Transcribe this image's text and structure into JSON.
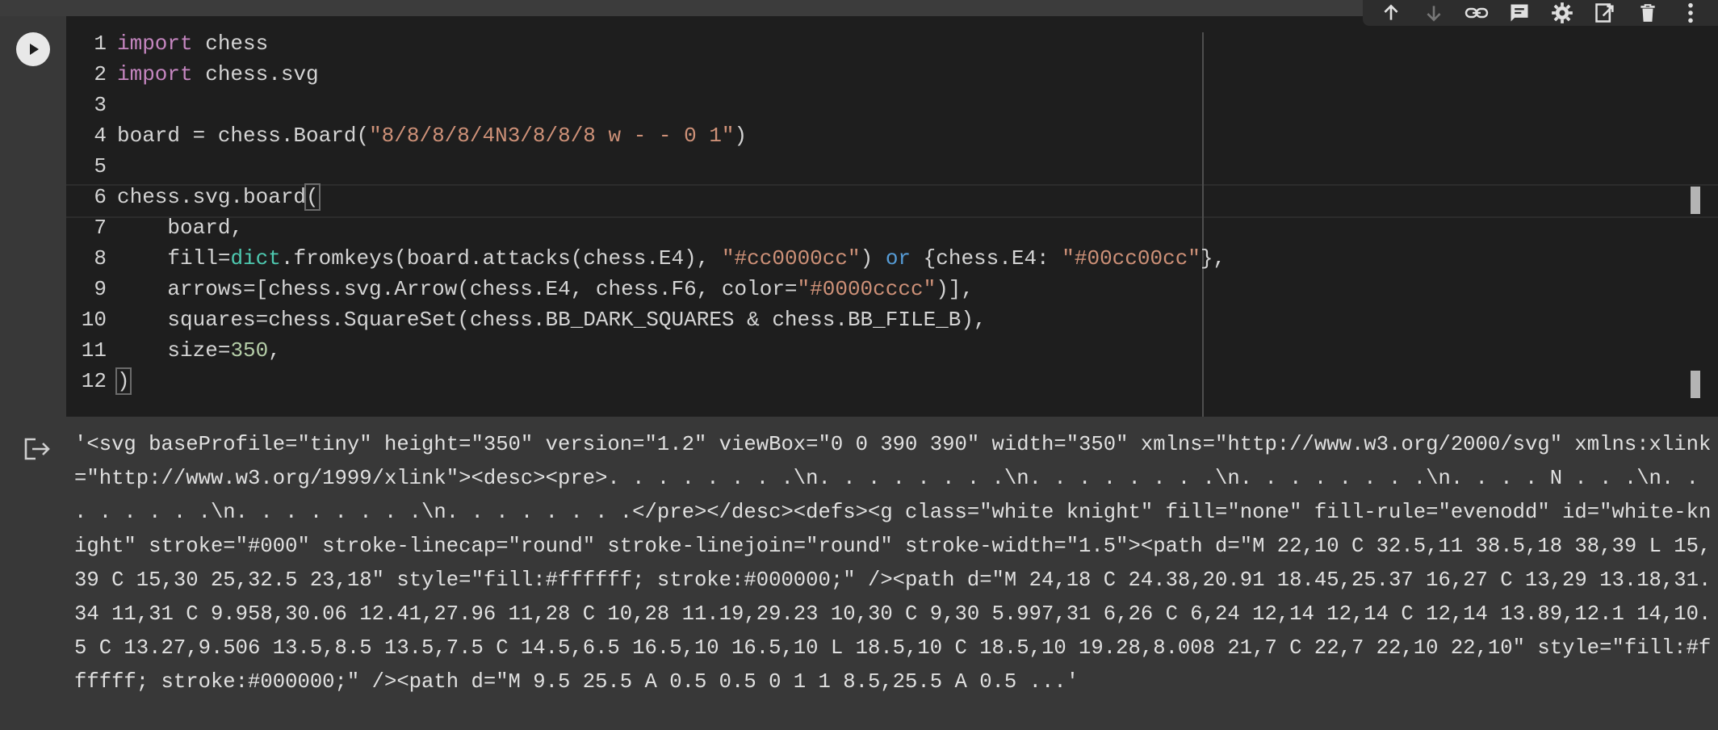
{
  "editor": {
    "line_numbers": [
      "1",
      "2",
      "3",
      "4",
      "5",
      "6",
      "7",
      "8",
      "9",
      "10",
      "11",
      "12"
    ],
    "tokens": {
      "l1_kw": "import",
      "l1_rest": " chess",
      "l2_kw": "import",
      "l2_rest": " chess.svg",
      "l4_a": "board = chess.Board(",
      "l4_str": "\"8/8/8/8/4N3/8/8/8 w - - 0 1\"",
      "l4_b": ")",
      "l6_a": "chess.svg.board",
      "l6_paren": "(",
      "l7": "    board,",
      "l8_a": "    fill=",
      "l8_dict": "dict",
      "l8_b": ".fromkeys(board.attacks(chess.E4), ",
      "l8_str1": "\"#cc0000cc\"",
      "l8_c": ") ",
      "l8_or": "or",
      "l8_d": " {chess.E4: ",
      "l8_str2": "\"#00cc00cc\"",
      "l8_e": "},",
      "l9_a": "    arrows=[chess.svg.Arrow(chess.E4, chess.F6, color=",
      "l9_str": "\"#0000cccc\"",
      "l9_b": ")],",
      "l10": "    squares=chess.SquareSet(chess.BB_DARK_SQUARES & chess.BB_FILE_B),",
      "l11_a": "    size=",
      "l11_num": "350",
      "l11_b": ",",
      "l12_paren": ")"
    }
  },
  "toolbar": {
    "icons": [
      "arrow-up-icon",
      "arrow-down-icon",
      "link-icon",
      "comment-icon",
      "gear-icon",
      "mirror-cell-icon",
      "trash-icon",
      "more-vert-icon"
    ]
  },
  "output": {
    "text": "'<svg baseProfile=\"tiny\" height=\"350\" version=\"1.2\" viewBox=\"0 0 390 390\" width=\"350\" xmlns=\"http://www.w3.org/2000/svg\" xmlns:xlink=\"http://www.w3.org/1999/xlink\"><desc><pre>. . . . . . . .\\n. . . . . . . .\\n. . . . . . . .\\n. . . . . . . .\\n. . . . N . . .\\n. . . . . . . .\\n. . . . . . . .\\n. . . . . . . .</pre></desc><defs><g class=\"white knight\" fill=\"none\" fill-rule=\"evenodd\" id=\"white-knight\" stroke=\"#000\" stroke-linecap=\"round\" stroke-linejoin=\"round\" stroke-width=\"1.5\"><path d=\"M 22,10 C 32.5,11 38.5,18 38,39 L 15,39 C 15,30 25,32.5 23,18\" style=\"fill:#ffffff; stroke:#000000;\" /><path d=\"M 24,18 C 24.38,20.91 18.45,25.37 16,27 C 13,29 13.18,31.34 11,31 C 9.958,30.06 12.41,27.96 11,28 C 10,28 11.19,29.23 10,30 C 9,30 5.997,31 6,26 C 6,24 12,14 12,14 C 12,14 13.89,12.1 14,10.5 C 13.27,9.506 13.5,8.5 13.5,7.5 C 14.5,6.5 16.5,10 16.5,10 L 18.5,10 C 18.5,10 19.28,8.008 21,7 C 22,7 22,10 22,10\" style=\"fill:#ffffff; stroke:#000000;\" /><path d=\"M 9.5 25.5 A 0.5 0.5 0 1 1 8.5,25.5 A 0.5 ...'"
  }
}
